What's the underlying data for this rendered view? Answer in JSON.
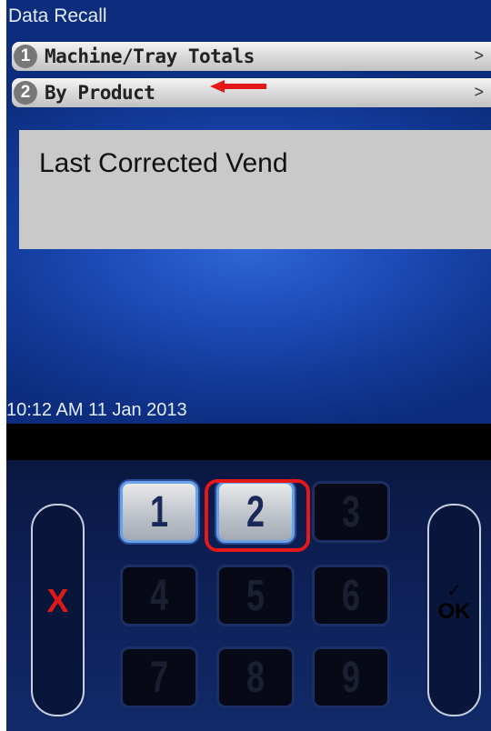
{
  "screen": {
    "title": "Data Recall",
    "menu": [
      {
        "number": "1",
        "label": "Machine/Tray Totals",
        "chevron": ">"
      },
      {
        "number": "2",
        "label": "By Product",
        "chevron": ">"
      }
    ],
    "panel_text": "Last Corrected Vend",
    "timestamp": "10:12 AM 11 Jan 2013"
  },
  "keypad": {
    "keys": [
      "1",
      "2",
      "3",
      "4",
      "5",
      "6",
      "7",
      "8",
      "9"
    ],
    "cancel_label": "X",
    "ok_check": "✓",
    "ok_label": "OK"
  },
  "colors": {
    "screen_blue": "#1e4bb8",
    "annotation_red": "#e41818",
    "panel_gray": "#c9c9c9"
  }
}
